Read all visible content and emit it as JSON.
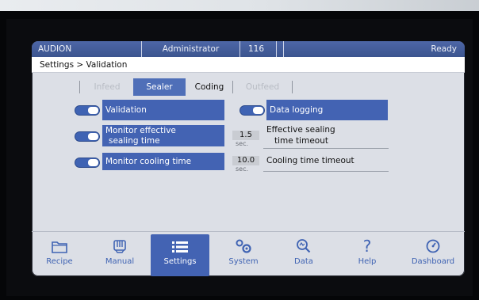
{
  "status_bar": {
    "app": "AUDION",
    "user": "Administrator",
    "number": "116",
    "status": "Ready"
  },
  "breadcrumb": "Settings > Validation",
  "tabs": [
    {
      "label": "Infeed",
      "state": "disabled"
    },
    {
      "label": "Sealer",
      "state": "active"
    },
    {
      "label": "Coding",
      "state": "normal"
    },
    {
      "label": "Outfeed",
      "state": "disabled"
    }
  ],
  "settings": {
    "validation": {
      "label": "Validation",
      "enabled": true
    },
    "data_logging": {
      "label": "Data logging",
      "enabled": true
    },
    "monitor_sealing": {
      "label_line1": "Monitor effective",
      "label_line2": "sealing time",
      "enabled": true
    },
    "sealing_timeout": {
      "label_line1": "Effective sealing",
      "label_line2": "time timeout",
      "value": "1.5",
      "unit": "sec."
    },
    "monitor_cooling": {
      "label": "Monitor cooling time",
      "enabled": true
    },
    "cooling_timeout": {
      "label": "Cooling time timeout",
      "value": "10.0",
      "unit": "sec."
    }
  },
  "nav": [
    {
      "label": "Recipe",
      "icon": "folder-icon"
    },
    {
      "label": "Manual",
      "icon": "hand-icon"
    },
    {
      "label": "Settings",
      "icon": "list-icon",
      "active": true
    },
    {
      "label": "System",
      "icon": "gears-icon"
    },
    {
      "label": "Data",
      "icon": "magnifier-icon"
    },
    {
      "label": "Help",
      "icon": "question-icon"
    },
    {
      "label": "Dashboard",
      "icon": "dashboard-icon"
    }
  ],
  "colors": {
    "accent": "#4363b3",
    "screen_bg": "#dcdfe6",
    "status_bar": "#445d9c"
  }
}
